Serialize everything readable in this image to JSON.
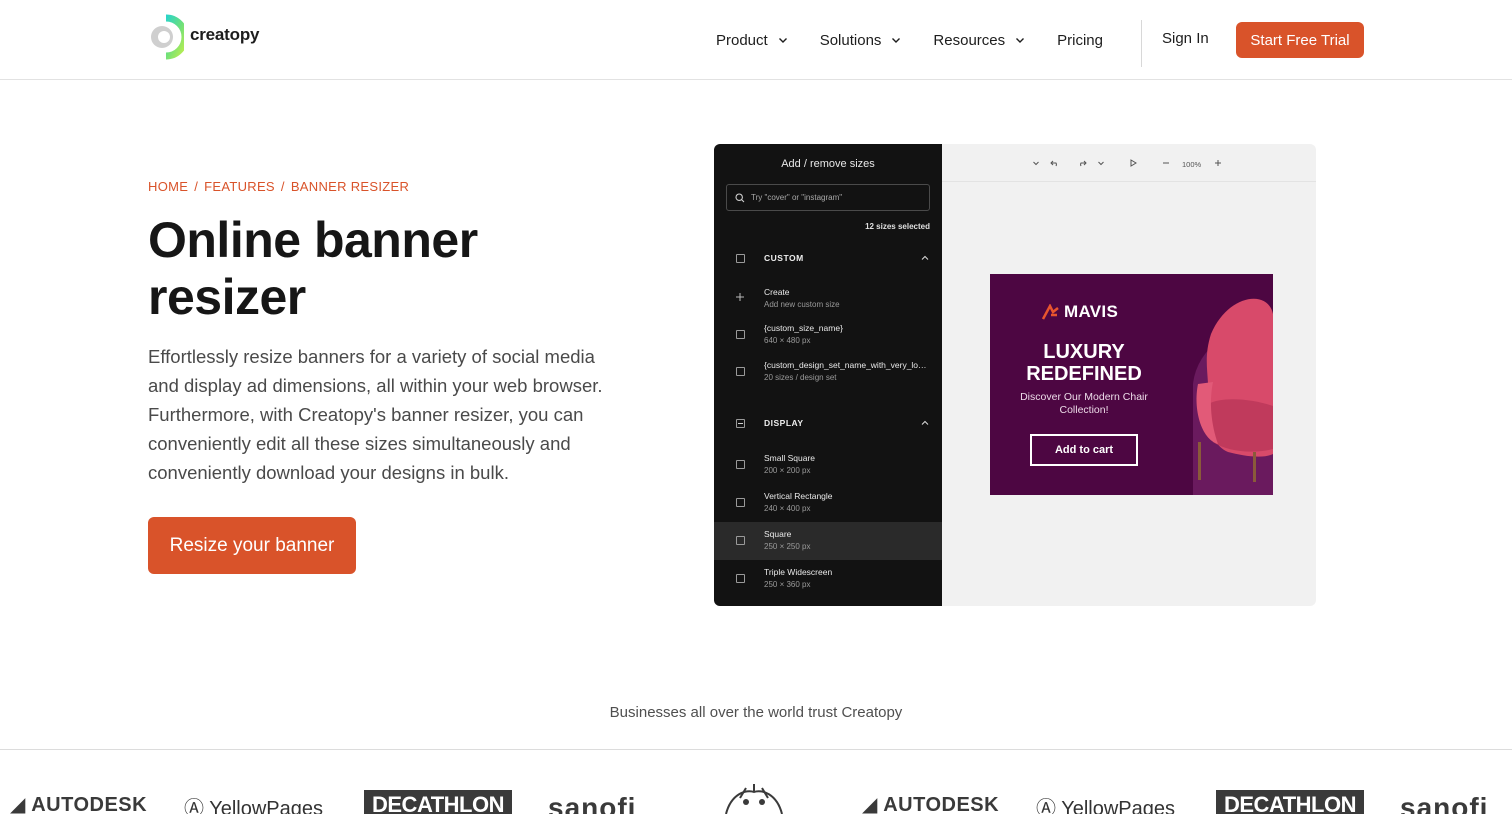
{
  "header": {
    "logo_text": "creatopy",
    "nav": [
      "Product",
      "Solutions",
      "Resources",
      "Pricing"
    ],
    "sign_in": "Sign In",
    "trial": "Start Free Trial"
  },
  "breadcrumb": [
    "HOME",
    "FEATURES",
    "BANNER RESIZER"
  ],
  "hero": {
    "title": "Online banner resizer",
    "description": "Effortlessly resize banners for a variety of social media and display ad dimensions, all within your web browser. Furthermore, with Creatopy's banner resizer, you can conveniently edit all these sizes simultaneously and conveniently download your designs in bulk.",
    "cta": "Resize your banner"
  },
  "editor": {
    "panel_title": "Add / remove sizes",
    "search_placeholder": "Try \"cover\" or \"instagram\"",
    "selected_count": "12 sizes selected",
    "groups": {
      "custom": "CUSTOM",
      "display": "DISPLAY"
    },
    "custom_items": [
      {
        "name": "Create",
        "size": "Add new custom size"
      },
      {
        "name": "{custom_size_name}",
        "size": "640 × 480 px"
      },
      {
        "name": "{custom_design_set_name_with_very_long_name}",
        "size": "20 sizes / design set"
      }
    ],
    "display_items": [
      {
        "name": "Small Square",
        "size": "200 × 200 px"
      },
      {
        "name": "Vertical Rectangle",
        "size": "240 × 400 px"
      },
      {
        "name": "Square",
        "size": "250 × 250 px"
      },
      {
        "name": "Triple Widescreen",
        "size": "250 × 360 px"
      }
    ],
    "zoom": "100%",
    "banner": {
      "brand": "MAVIS",
      "headline": "LUXURY REDEFINED",
      "subline": "Discover Our Modern Chair Collection!",
      "button": "Add to cart",
      "bg_color": "#4d0642"
    }
  },
  "trust": {
    "text": "Businesses all over the world trust Creatopy",
    "logos": [
      "AUTODESK",
      "YellowPages",
      "DECATHLON",
      "sanofi",
      "AUTODESK",
      "YellowPages",
      "DECATHLON",
      "sanofi"
    ]
  },
  "colors": {
    "accent": "#d9532a",
    "panel_bg": "#121212"
  }
}
